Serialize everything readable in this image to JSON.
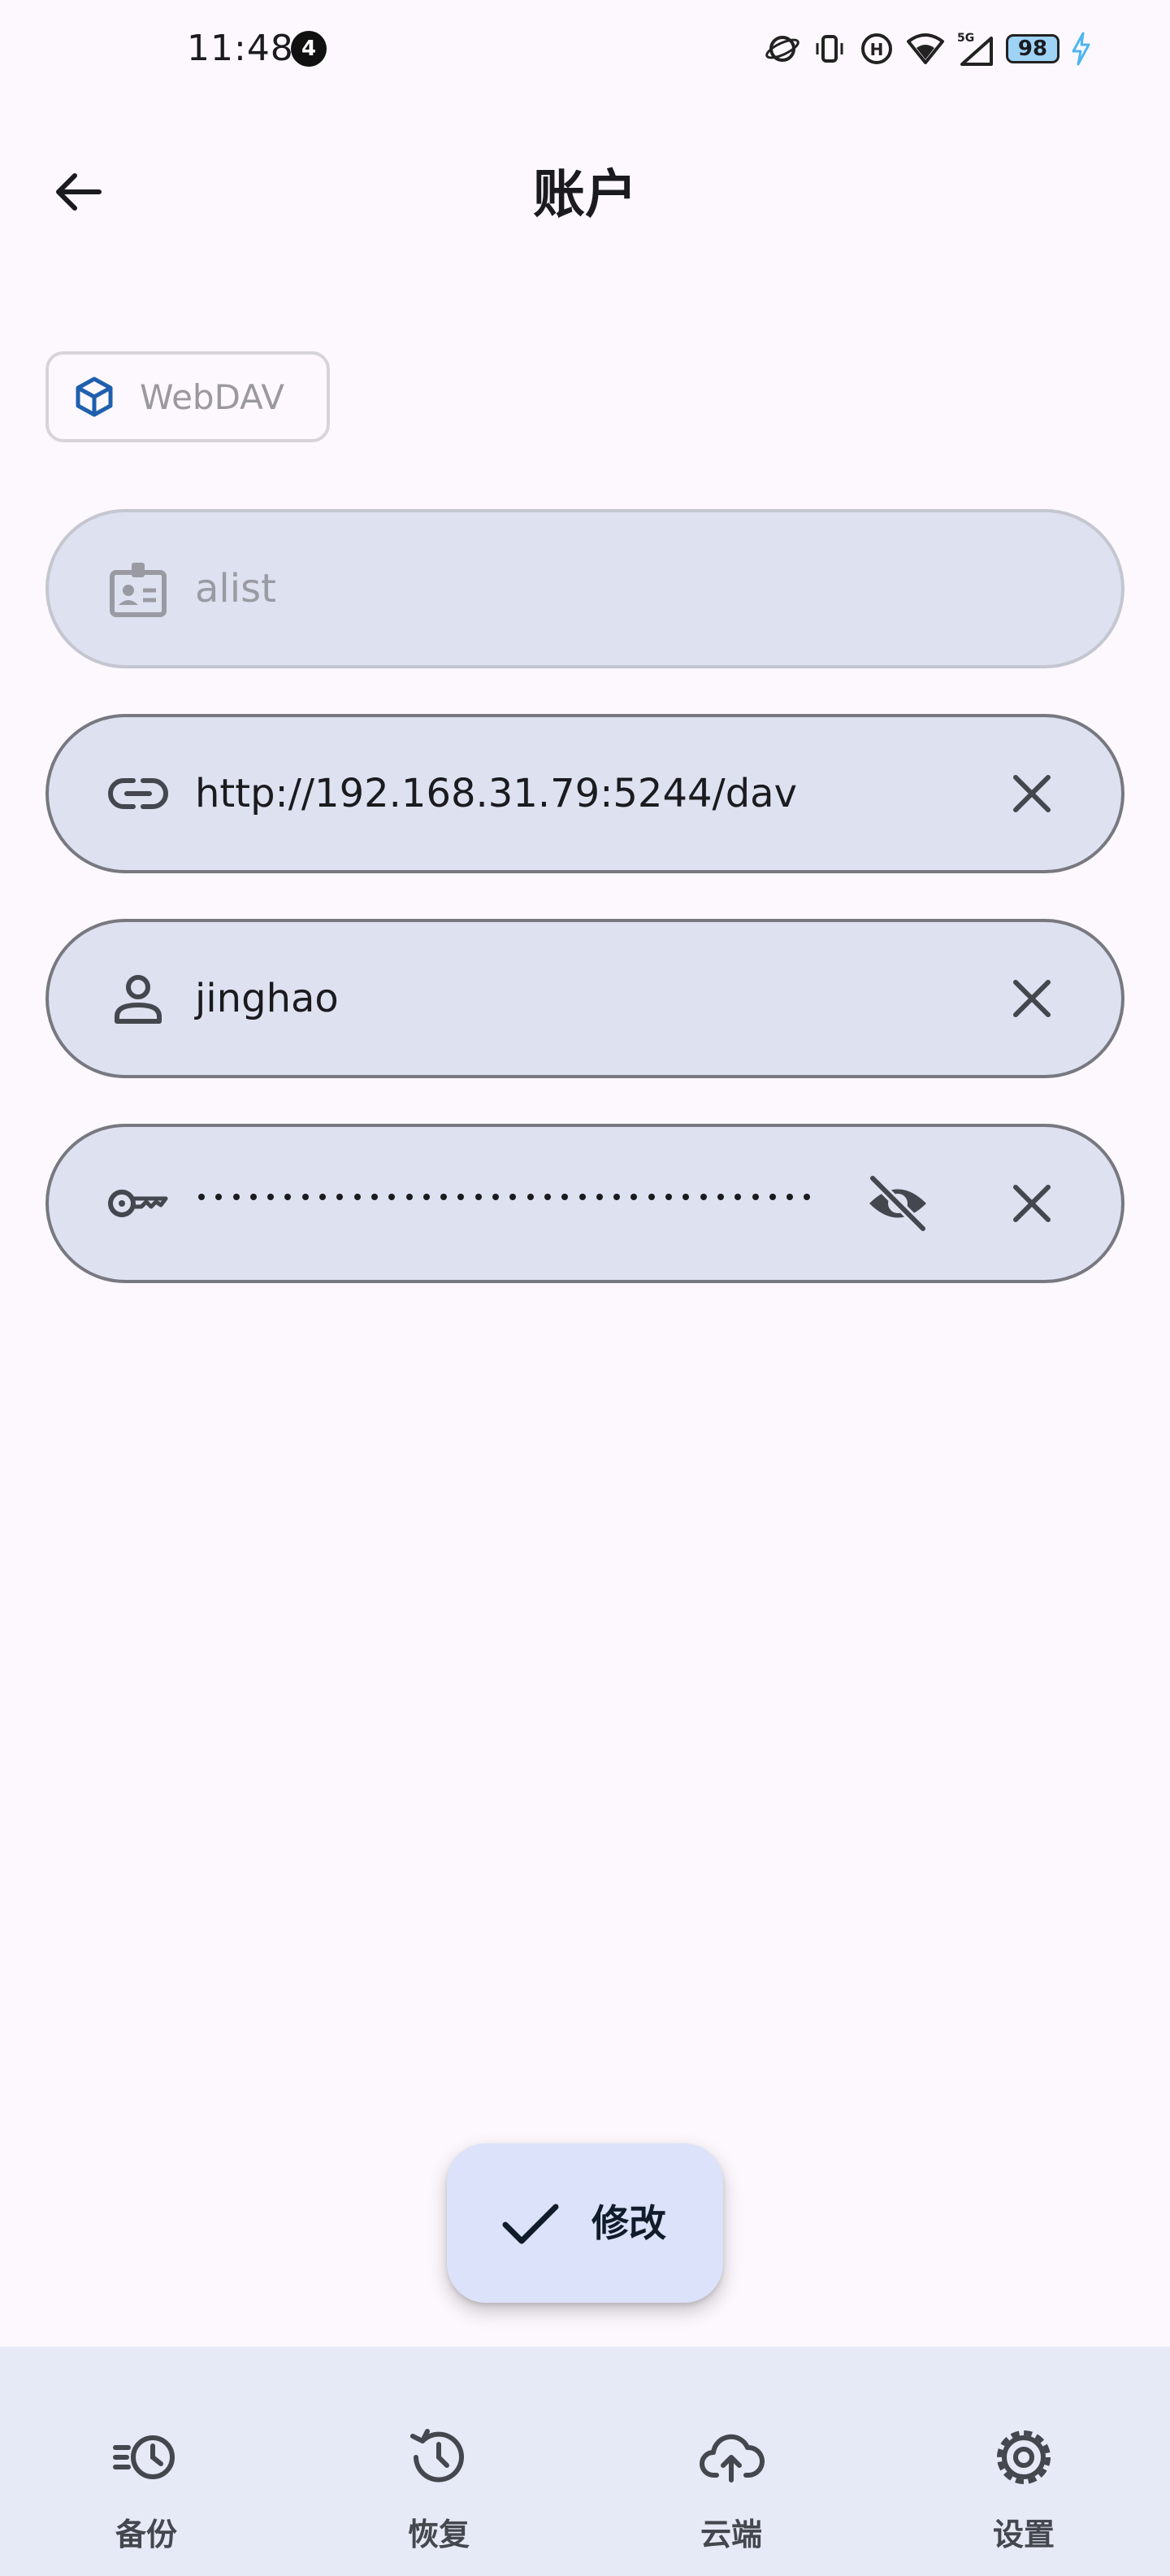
{
  "status_bar": {
    "time": "11:48",
    "notification_count": "4",
    "battery": "98"
  },
  "app_bar": {
    "title": "账户"
  },
  "account_type_chip": {
    "label": "WebDAV"
  },
  "fields": {
    "name": {
      "value": "alist",
      "icon": "badge-icon",
      "enabled": false
    },
    "url": {
      "value": "http://192.168.31.79:5244/dav",
      "icon": "link-icon"
    },
    "username": {
      "value": "jinghao",
      "icon": "person-icon"
    },
    "password": {
      "masked": true,
      "icon": "key-icon",
      "visibility_icon": "visibility-off-icon"
    }
  },
  "fab": {
    "label": "修改",
    "icon": "check-icon"
  },
  "bottom_nav": {
    "items": [
      {
        "label": "备份",
        "icon": "backup-clock-icon"
      },
      {
        "label": "恢复",
        "icon": "history-icon"
      },
      {
        "label": "云端",
        "icon": "cloud-upload-icon"
      },
      {
        "label": "设置",
        "icon": "gear-icon"
      }
    ]
  },
  "colors": {
    "background": "#fdf8fd",
    "field_fill": "#dde1f0",
    "fab_fill": "#dbe2f9",
    "nav_fill": "#e6e9f6",
    "chip_icon": "#1f5fae"
  }
}
